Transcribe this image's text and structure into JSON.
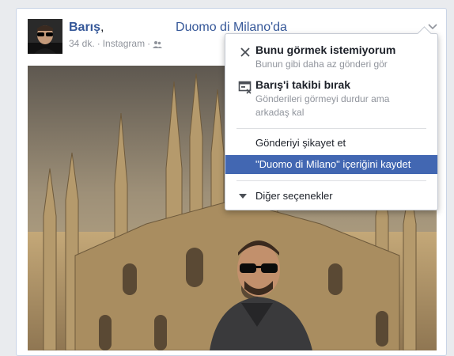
{
  "post": {
    "author_name": "Barış",
    "location_prefix": ", ",
    "location": "Duomo di Milano",
    "location_suffix": "'da",
    "time": "34 dk.",
    "separator": "·",
    "source": "Instagram",
    "audience_icon": "friends-icon"
  },
  "menu": {
    "items": [
      {
        "title": "Bunu görmek istemiyorum",
        "subtitle": "Bunun gibi daha az gönderi gör",
        "icon": "close-icon"
      },
      {
        "title": "Barış'i takibi bırak",
        "subtitle": "Gönderileri görmeyi durdur ama arkadaş kal",
        "icon": "unfollow-icon"
      }
    ],
    "report": "Gönderiyi şikayet et",
    "save": "\"Duomo di Milano\" içeriğini kaydet",
    "more": "Diğer seçenekler"
  },
  "colors": {
    "link": "#365899",
    "highlight": "#4267b2",
    "muted": "#90949c"
  }
}
